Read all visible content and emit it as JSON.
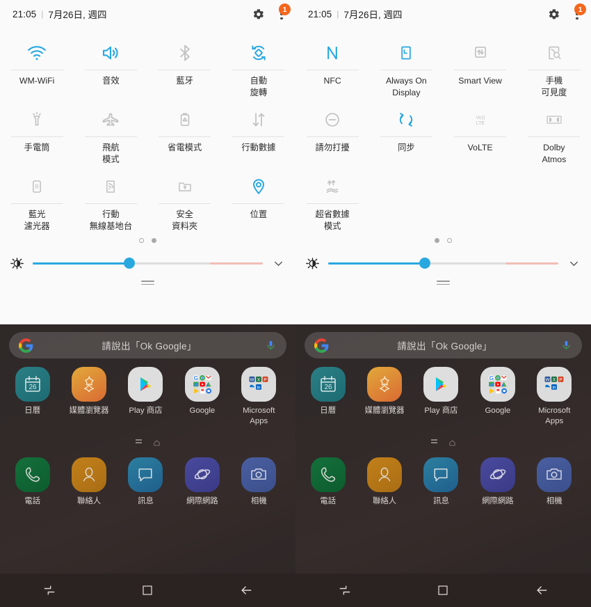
{
  "status": {
    "time": "21:05",
    "separator": "|",
    "date": "7月26日, 週四",
    "notification_count": "1"
  },
  "panels": [
    {
      "id": "panel-page-2",
      "page_dots": [
        "off",
        "on"
      ],
      "tiles": [
        {
          "label": "WM-WiFi",
          "icon": "wifi-icon",
          "state": "on"
        },
        {
          "label": "音效",
          "icon": "sound-icon",
          "state": "on"
        },
        {
          "label": "藍牙",
          "icon": "bluetooth-icon",
          "state": "off"
        },
        {
          "label": "自動\n旋轉",
          "icon": "auto-rotate-icon",
          "state": "on"
        },
        {
          "label": "手電筒",
          "icon": "flashlight-icon",
          "state": "off"
        },
        {
          "label": "飛航\n模式",
          "icon": "airplane-icon",
          "state": "off"
        },
        {
          "label": "省電模式",
          "icon": "power-saving-icon",
          "state": "off"
        },
        {
          "label": "行動數據",
          "icon": "mobile-data-icon",
          "state": "off"
        },
        {
          "label": "藍光\n濾光器",
          "icon": "blue-light-filter-icon",
          "state": "off"
        },
        {
          "label": "行動\n無線基地台",
          "icon": "mobile-hotspot-icon",
          "state": "off"
        },
        {
          "label": "安全\n資料夾",
          "icon": "secure-folder-icon",
          "state": "off"
        },
        {
          "label": "位置",
          "icon": "location-icon",
          "state": "on"
        }
      ],
      "brightness": {
        "value_percent": 42,
        "warm_zone_percent": 23
      }
    },
    {
      "id": "panel-page-1",
      "page_dots": [
        "on",
        "off"
      ],
      "tiles": [
        {
          "label": "NFC",
          "icon": "nfc-icon",
          "state": "on"
        },
        {
          "label": "Always On\nDisplay",
          "icon": "always-on-display-icon",
          "state": "on"
        },
        {
          "label": "Smart View",
          "icon": "smart-view-icon",
          "state": "off"
        },
        {
          "label": "手機\n可見度",
          "icon": "phone-visibility-icon",
          "state": "off"
        },
        {
          "label": "請勿打擾",
          "icon": "do-not-disturb-icon",
          "state": "off"
        },
        {
          "label": "同步",
          "icon": "sync-icon",
          "state": "on"
        },
        {
          "label": "VoLTE",
          "icon": "volte-icon",
          "state": "off"
        },
        {
          "label": "Dolby\nAtmos",
          "icon": "dolby-atmos-icon",
          "state": "off"
        },
        {
          "label": "超省數據\n模式",
          "icon": "ultra-data-saving-icon",
          "state": "off"
        },
        {
          "label": "",
          "icon": "",
          "state": "empty"
        },
        {
          "label": "",
          "icon": "",
          "state": "empty"
        },
        {
          "label": "",
          "icon": "",
          "state": "empty"
        }
      ],
      "brightness": {
        "value_percent": 42,
        "warm_zone_percent": 23
      }
    }
  ],
  "home": {
    "search": {
      "placeholder": "請說出「Ok Google」",
      "logo": "google-g-icon",
      "mic": "microphone-icon"
    },
    "apps": [
      {
        "label": "日曆",
        "icon": "calendar-icon",
        "day": "26"
      },
      {
        "label": "媒體瀏覽器",
        "icon": "gallery-icon"
      },
      {
        "label": "Play 商店",
        "icon": "play-store-icon"
      },
      {
        "label": "Google",
        "icon": "google-folder-icon"
      },
      {
        "label": "Microsoft\nApps",
        "icon": "microsoft-folder-icon"
      }
    ],
    "dock": [
      {
        "label": "電話",
        "icon": "phone-icon"
      },
      {
        "label": "聯絡人",
        "icon": "contacts-icon"
      },
      {
        "label": "訊息",
        "icon": "messages-icon"
      },
      {
        "label": "網際網路",
        "icon": "internet-icon"
      },
      {
        "label": "相機",
        "icon": "camera-icon"
      }
    ],
    "navbar": [
      {
        "name": "recents-button",
        "icon": "recents-icon"
      },
      {
        "name": "home-button",
        "icon": "home-square-icon"
      },
      {
        "name": "back-button",
        "icon": "back-arrow-icon"
      }
    ]
  },
  "colors": {
    "accent_blue": "#29a8e0",
    "badge_orange": "#f4671c",
    "panel_bg": "#fafafa",
    "icon_off": "#c2c2c2",
    "label": "#2b2b2b"
  }
}
